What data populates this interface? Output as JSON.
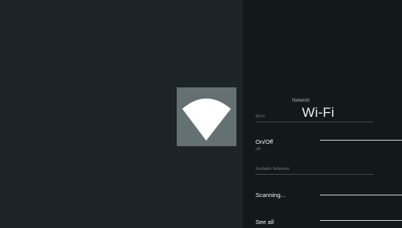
{
  "header": {
    "breadcrumb": "Network",
    "title": "Wi-Fi",
    "icon": "wifi-icon"
  },
  "sections": {
    "wifi_label": "Wi-Fi",
    "available_networks_label": "Available Networks"
  },
  "items": {
    "on_off": {
      "title": "On/Off",
      "subtitle": "Off"
    },
    "scanning": {
      "title": "Scanning..."
    },
    "see_all": {
      "title": "See all"
    }
  },
  "colors": {
    "left_background": "#1d2427",
    "right_background": "#13191a",
    "icon_tile": "#647072",
    "icon_glyph": "#ffffff"
  }
}
